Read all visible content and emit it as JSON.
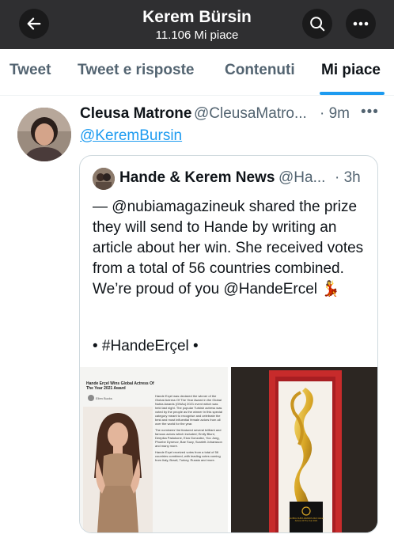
{
  "header": {
    "title": "Kerem Bürsin",
    "subtitle": "11.106 Mi piace"
  },
  "tabs": [
    {
      "label": "Tweet"
    },
    {
      "label": "Tweet e risposte"
    },
    {
      "label": "Contenuti"
    },
    {
      "label": "Mi piace"
    }
  ],
  "tweet": {
    "name": "Cleusa Matrone",
    "handle": "@CleusaMatro...",
    "time": "· 9m",
    "more": "•••",
    "mention": "@KeremBursin"
  },
  "quote": {
    "name": "Hande & Kerem News",
    "handle": "@Ha...",
    "time": "· 3h",
    "text": "— @nubiamagazineuk shared the prize they will send to Hande by writing an article about her win. She received votes from a total of 56 countries combined. We’re proud of you @HandeErcel 💃",
    "hashtag": "• #HandeErçel •"
  },
  "article": {
    "title": "Hande Erçel Wins Global Actress Of The Year 2021 Award",
    "author": "Ellen Bucks",
    "p1": "Hande Erçel was declared the winner of the Global Actress Of The Year Award in the Global Nubia Awards (GNAs) 2021 event which was held last night. The popular Turkish actress was voted by the people as the winner in this special category meant to recognise and celebrate the best and most influential female actors from all over the world for the year.",
    "p2": "The nominees’ list featured several brilliant and famous actors which included; Emily Blunt, Deepika Padukone, Eiza Gonzalez, Yoo Jung, Phoebe Dynevor, Bae Suzy, Scarlett Johansson and many more.",
    "p3": "Hande Erçel received votes from a total of 56 countries combined, with leading votes coming from Italy, Brazil, Turkey, Russia and more.",
    "plaque": "GLOBAL NUBIA AWARDS 2021 Global Actress Of The Year 2021"
  }
}
